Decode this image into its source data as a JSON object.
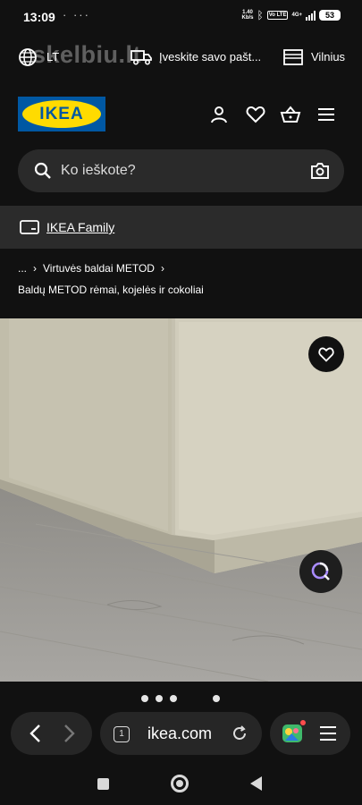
{
  "status_bar": {
    "time": "13:09",
    "dots": "· ···",
    "net_speed_value": "1.40",
    "net_speed_unit": "Kb/s",
    "volte": "Vo LTE",
    "network": "4G+",
    "battery": "53"
  },
  "top_strip": {
    "language": "LT",
    "watermark": "skelbiu.lt",
    "postal_prompt": "Įveskite savo pašt...",
    "store_city": "Vilnius"
  },
  "header": {
    "logo_text": "IKEA",
    "colors": {
      "logo_blue": "#0058a3",
      "logo_yellow": "#ffdb00"
    },
    "icons": [
      "user-icon",
      "heart-icon",
      "basket-icon",
      "hamburger-icon"
    ]
  },
  "search": {
    "placeholder": "Ko ieškote?"
  },
  "family": {
    "label": "IKEA Family"
  },
  "breadcrumb": {
    "ellipsis": "...",
    "parent": "Virtuvės baldai METOD",
    "current": "Baldų METOD rėmai, kojelės ir cokoliai"
  },
  "carousel": {
    "slide_count": 4,
    "active_index": 3
  },
  "browser": {
    "tab_count": "1",
    "url": "ikea.com"
  }
}
